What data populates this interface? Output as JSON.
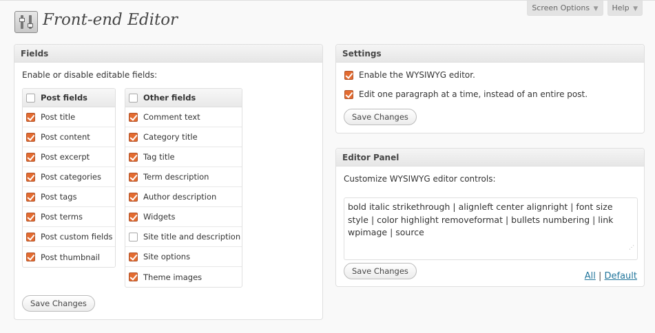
{
  "header": {
    "title": "Front-end Editor",
    "screen_options_label": "Screen Options",
    "help_label": "Help",
    "tab_arrow": "▼"
  },
  "fields_box": {
    "title": "Fields",
    "intro": "Enable or disable editable fields:",
    "post_fields": {
      "header": "Post fields",
      "header_checked": false,
      "items": [
        {
          "label": "Post title",
          "checked": true
        },
        {
          "label": "Post content",
          "checked": true
        },
        {
          "label": "Post excerpt",
          "checked": true
        },
        {
          "label": "Post categories",
          "checked": true
        },
        {
          "label": "Post tags",
          "checked": true
        },
        {
          "label": "Post terms",
          "checked": true
        },
        {
          "label": "Post custom fields",
          "checked": true
        },
        {
          "label": "Post thumbnail",
          "checked": true
        }
      ]
    },
    "other_fields": {
      "header": "Other fields",
      "header_checked": false,
      "items": [
        {
          "label": "Comment text",
          "checked": true
        },
        {
          "label": "Category title",
          "checked": true
        },
        {
          "label": "Tag title",
          "checked": true
        },
        {
          "label": "Term description",
          "checked": true
        },
        {
          "label": "Author description",
          "checked": true
        },
        {
          "label": "Widgets",
          "checked": true
        },
        {
          "label": "Site title and description",
          "checked": false
        },
        {
          "label": "Site options",
          "checked": true
        },
        {
          "label": "Theme images",
          "checked": true
        }
      ]
    },
    "save_label": "Save Changes"
  },
  "settings_box": {
    "title": "Settings",
    "options": [
      {
        "label": "Enable the WYSIWYG editor.",
        "checked": true
      },
      {
        "label": "Edit one paragraph at a time, instead of an entire post.",
        "checked": true
      }
    ],
    "save_label": "Save Changes"
  },
  "editor_panel": {
    "title": "Editor Panel",
    "intro": "Customize WYSIWYG editor controls:",
    "controls_value": "bold italic strikethrough | alignleft center alignright | font size style | color highlight removeformat | bullets numbering | link wpimage | source",
    "save_label": "Save Changes",
    "link_all": "All",
    "separator": "|",
    "link_default": "Default"
  },
  "colors": {
    "checkbox_checked": "#e36b30",
    "link": "#21759b",
    "page_bg": "#f9f9f9"
  }
}
